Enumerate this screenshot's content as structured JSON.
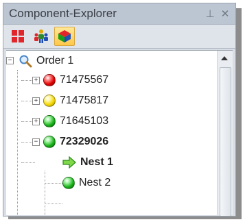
{
  "window": {
    "title": "Component-Explorer",
    "pin_glyph": "⊥",
    "close_glyph": "✕"
  },
  "toolbar": {
    "buttons": [
      {
        "icon": "grid-icon",
        "active": false
      },
      {
        "icon": "people-icon",
        "active": false
      },
      {
        "icon": "components-icon",
        "active": true
      }
    ]
  },
  "tree": {
    "root": {
      "label": "Order 1",
      "icon": "magnifier-icon",
      "expander": "−"
    },
    "items": [
      {
        "label": "71475567",
        "status_color": "#e00000",
        "expander": "+",
        "bold": false
      },
      {
        "label": "71475817",
        "status_color": "#f2d600",
        "expander": "+",
        "bold": false
      },
      {
        "label": "71645103",
        "status_color": "#18b018",
        "expander": "+",
        "bold": false
      },
      {
        "label": "72329026",
        "status_color": "#18b018",
        "expander": "−",
        "bold": true
      }
    ],
    "children": [
      {
        "label": "Nest 1",
        "icon": "arrow-right-icon",
        "bold": true
      },
      {
        "label": "Nest 2",
        "icon": "green-ball-icon",
        "status_color": "#18b018",
        "bold": false
      }
    ]
  }
}
